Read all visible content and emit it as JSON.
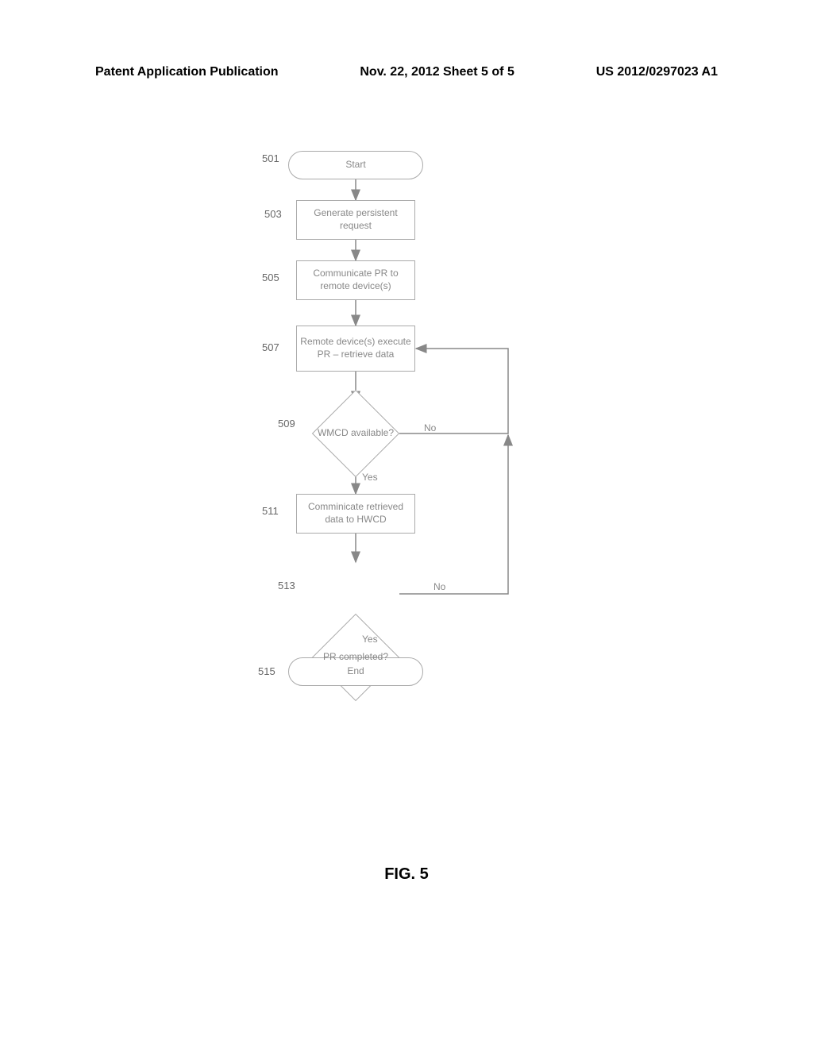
{
  "header": {
    "left": "Patent Application Publication",
    "center": "Nov. 22, 2012  Sheet 5 of 5",
    "right": "US 2012/0297023 A1"
  },
  "nodes": {
    "start": "Start",
    "n503": "Generate persistent request",
    "n505": "Communicate PR to remote device(s)",
    "n507": "Remote device(s) execute PR – retrieve data",
    "n509": "WMCD available?",
    "n511": "Comminicate retrieved data to HWCD",
    "n513": "PR completed?",
    "end": "End"
  },
  "labels": {
    "l501": "501",
    "l503": "503",
    "l505": "505",
    "l507": "507",
    "l509": "509",
    "l511": "511",
    "l513": "513",
    "l515": "515"
  },
  "edges": {
    "yes": "Yes",
    "no": "No"
  },
  "figure": "FIG. 5"
}
